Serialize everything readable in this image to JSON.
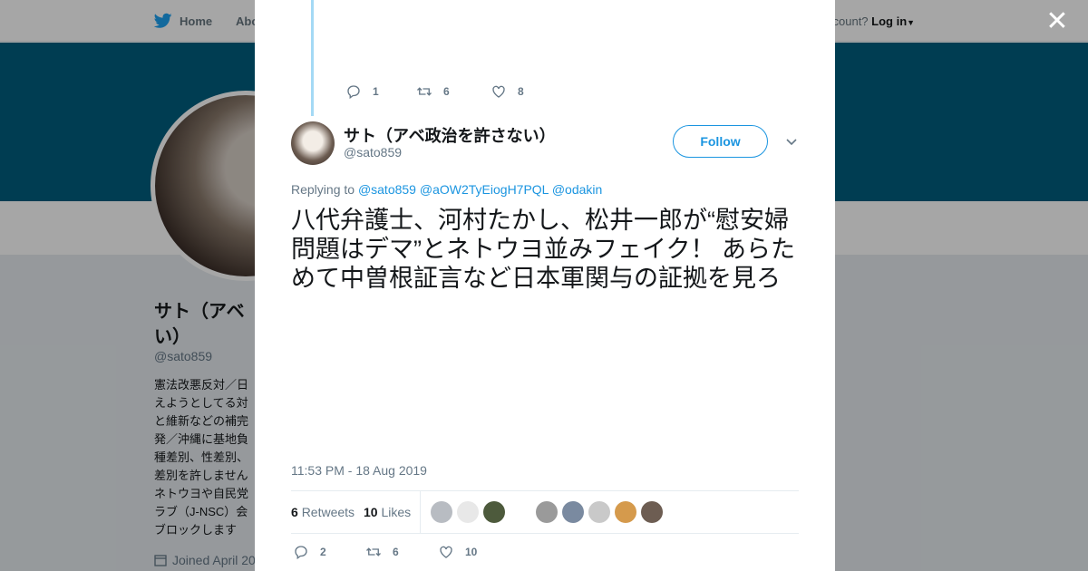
{
  "background": {
    "nav": {
      "home": "Home",
      "about": "Abo",
      "account_prompt": "ccount?",
      "login": "Log in"
    },
    "profile": {
      "name": "サト（アベ政治を許さない）",
      "name_visible": "サト（アベ\nい）",
      "handle": "@sato859",
      "bio": "憲法改悪反対／日\nえようとしてる対\nと維新などの補完\n発／沖縄に基地負\n種差別、性差別、\n差別を許しません\nネトウヨや自民党\nラブ（J-NSC）会\nブロックします",
      "joined": "Joined April 20"
    }
  },
  "close_icon_glyph": "✕",
  "prev_tweet_actions": {
    "replies": "1",
    "retweets": "6",
    "likes": "8"
  },
  "tweet": {
    "name": "サト（アベ政治を許さない）",
    "handle": "@sato859",
    "follow_label": "Follow",
    "replying_prefix": "Replying to",
    "replying_to": [
      "@sato859",
      "@aOW2TyEiogH7PQL",
      "@odakin"
    ],
    "text": "八代弁護士、河村たかし、松井一郎が“慰安婦問題はデマ”とネトウヨ並みフェイク！ あらためて中曽根証言など日本軍関与の証拠を見ろ",
    "timestamp": "11:53 PM - 18 Aug 2019",
    "retweets_count": "6",
    "retweets_label": "Retweets",
    "likes_count": "10",
    "likes_label": "Likes",
    "actions": {
      "replies": "2",
      "retweets": "6",
      "likes": "10"
    }
  },
  "colors": {
    "accent": "#1b95e0",
    "banner": "#005f7f",
    "thread": "#a4d9f5"
  }
}
